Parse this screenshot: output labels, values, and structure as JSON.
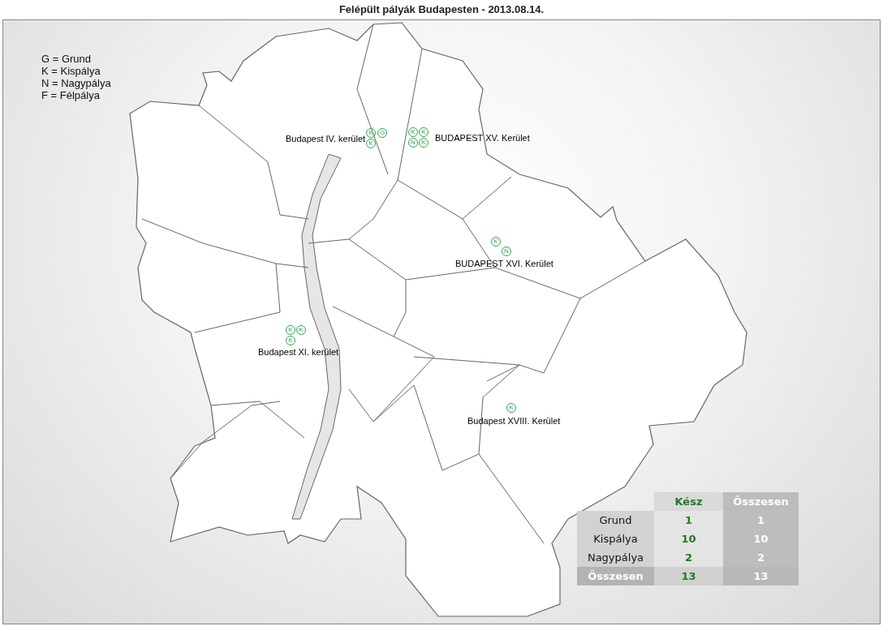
{
  "title": "Felépült pályák Budapesten - 2013.08.14.",
  "legend": [
    "G = Grund",
    "K = Kispálya",
    "N = Nagypálya",
    "F = Félpálya"
  ],
  "districts": [
    {
      "name": "Budapest IV. kerület",
      "markers": [
        "K",
        "G",
        "K"
      ]
    },
    {
      "name": "BUDAPEST XV. Kerület",
      "markers": [
        "K",
        "K",
        "N",
        "K"
      ]
    },
    {
      "name": "BUDAPEST XVI. Kerület",
      "markers": [
        "K",
        "N"
      ]
    },
    {
      "name": "Budapest XI. kerület",
      "markers": [
        "K",
        "K",
        "K"
      ]
    },
    {
      "name": "Budapest XVIII. Kerület",
      "markers": [
        "K"
      ]
    }
  ],
  "table": {
    "columns": [
      "Kész",
      "Összesen"
    ],
    "rows": [
      {
        "kind": "data",
        "label": "Grund",
        "values": [
          "1",
          "1"
        ]
      },
      {
        "kind": "data",
        "label": "Kispálya",
        "values": [
          "10",
          "10"
        ]
      },
      {
        "kind": "data",
        "label": "Nagypálya",
        "values": [
          "2",
          "2"
        ]
      },
      {
        "kind": "total",
        "label": "Összesen",
        "values": [
          "13",
          "13"
        ]
      }
    ]
  }
}
